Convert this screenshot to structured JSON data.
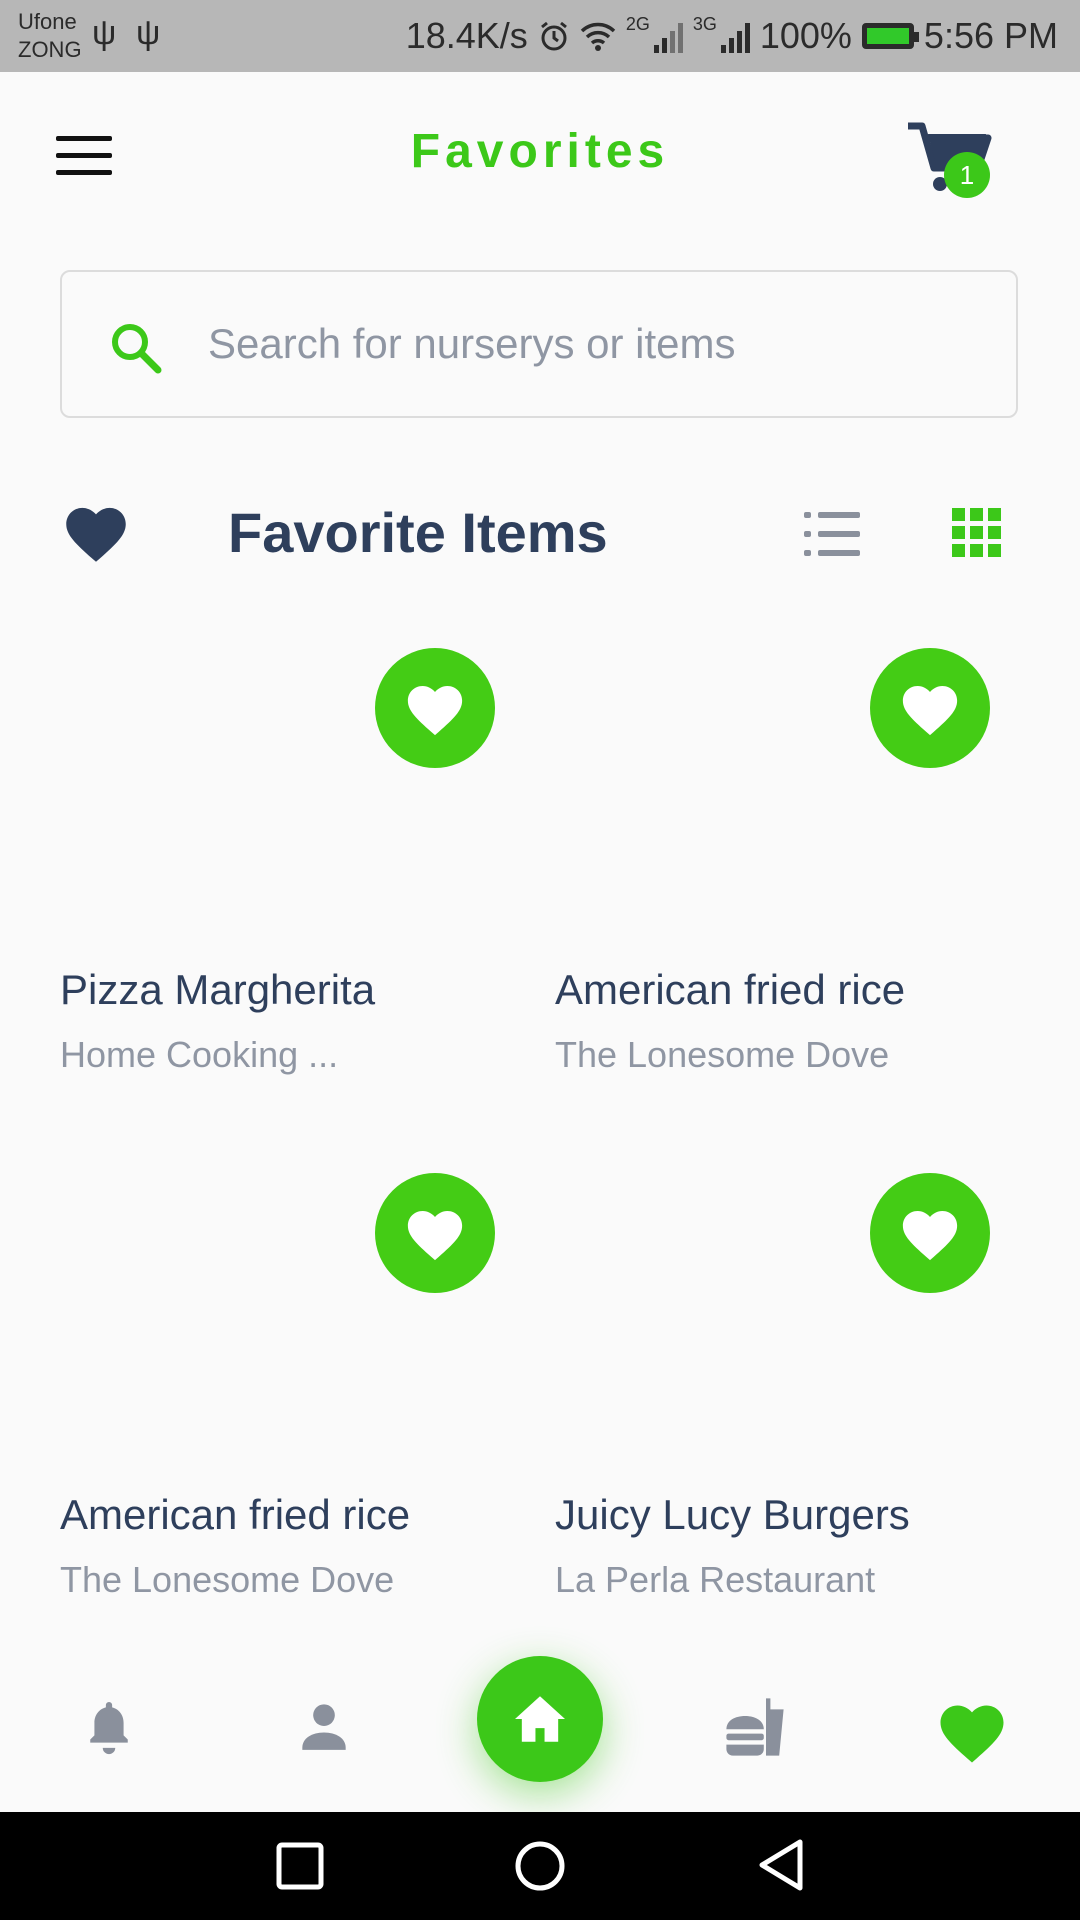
{
  "status_bar": {
    "carrier_1": "Ufone",
    "carrier_2": "ZONG",
    "speed": "18.4K/s",
    "net_2g": "2G",
    "net_3g": "3G",
    "battery": "100%",
    "time": "5:56 PM"
  },
  "header": {
    "title": "Favorites",
    "cart_count": "1"
  },
  "search": {
    "placeholder": "Search for nurserys or items",
    "value": ""
  },
  "section": {
    "title": "Favorite Items"
  },
  "items": [
    {
      "name": "Pizza Margherita",
      "restaurant": "Home Cooking ..."
    },
    {
      "name": "American fried rice",
      "restaurant": "The Lonesome Dove"
    },
    {
      "name": "American fried rice",
      "restaurant": "The Lonesome Dove"
    },
    {
      "name": "Juicy Lucy Burgers",
      "restaurant": "La Perla Restaurant"
    }
  ],
  "icons": {
    "menu": "hamburger-icon",
    "cart": "cart-icon",
    "search": "search-icon",
    "section": "heart-icon",
    "list_view": "list-icon",
    "grid_view": "grid-icon",
    "favorite": "heart-icon",
    "nav": [
      "bell-icon",
      "person-icon",
      "home-icon",
      "fastfood-icon",
      "heart-icon"
    ]
  },
  "colors": {
    "accent": "#3cc819",
    "text_dark": "#2e3f5c",
    "text_muted": "#8f96a3",
    "nav_inactive": "#8a909c"
  }
}
